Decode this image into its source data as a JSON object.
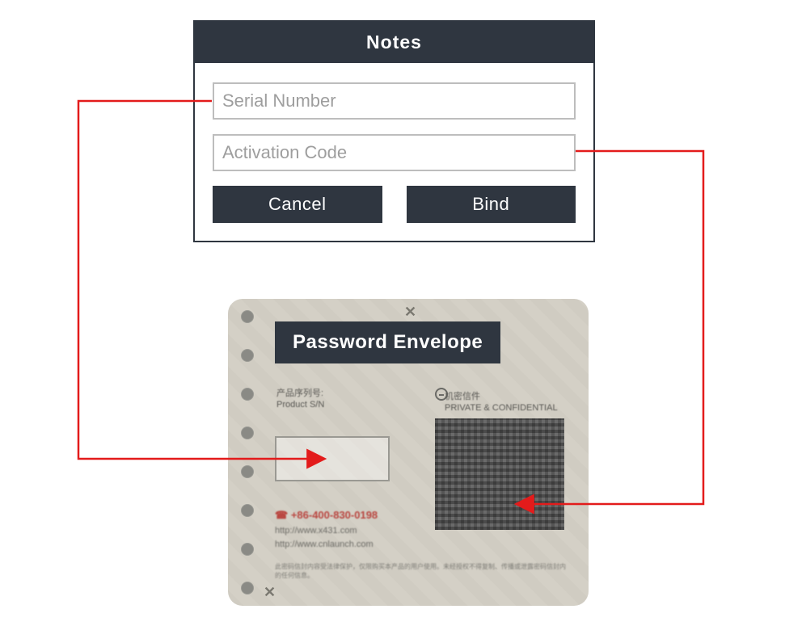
{
  "dialog": {
    "title": "Notes",
    "serial_placeholder": "Serial Number",
    "activation_placeholder": "Activation Code",
    "cancel_label": "Cancel",
    "bind_label": "Bind"
  },
  "envelope": {
    "title": "Password Envelope",
    "sn_label_line1": "产品序列号:",
    "sn_label_line2": "Product S/N",
    "conf_label_line1": "机密信件",
    "conf_label_line2": "PRIVATE & CONFIDENTIAL",
    "phone": "+86-400-830-0198",
    "url1": "http://www.x431.com",
    "url2": "http://www.cnlaunch.com",
    "fineprint": "此密码信封内容受法律保护，仅限购买本产品的用户使用。未经授权不得复制、传播或泄露密码信封内的任何信息。"
  },
  "colors": {
    "accent_red": "#e31b1b",
    "dark": "#2f3640"
  }
}
